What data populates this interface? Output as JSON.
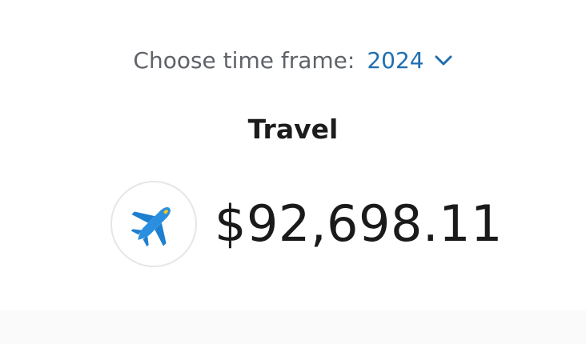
{
  "timeframe": {
    "label": "Choose time frame:",
    "selected_value": "2024",
    "dropdown_icon": "chevron-down-icon"
  },
  "category": {
    "title": "Travel",
    "icon": "airplane-icon",
    "amount": "$92,698.11"
  },
  "colors": {
    "accent": "#1f6fb0",
    "label_gray": "#5f6368",
    "airplane_blue": "#2a8fe0",
    "airplane_yellow": "#f5c518"
  }
}
